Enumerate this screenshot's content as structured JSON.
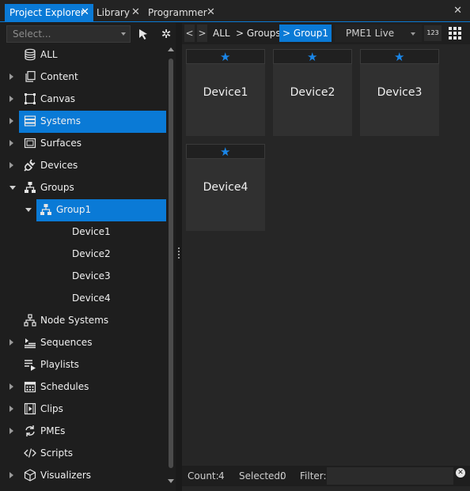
{
  "tabs": [
    {
      "label": "Project Explorer",
      "active": true
    },
    {
      "label": "Library",
      "active": false
    },
    {
      "label": "Programmer",
      "active": false
    }
  ],
  "left": {
    "select_placeholder": "Select...",
    "tree": [
      {
        "label": "ALL",
        "icon": "database-icon"
      },
      {
        "label": "Content",
        "icon": "content-icon"
      },
      {
        "label": "Canvas",
        "icon": "canvas-icon"
      },
      {
        "label": "Systems",
        "icon": "systems-icon",
        "selected": true
      },
      {
        "label": "Surfaces",
        "icon": "surfaces-icon"
      },
      {
        "label": "Devices",
        "icon": "plug-icon"
      },
      {
        "label": "Groups",
        "icon": "hierarchy-icon",
        "expanded": true
      },
      {
        "label": "Group1",
        "icon": "hierarchy-icon",
        "selected": true,
        "expanded": true
      },
      {
        "label": "Device1"
      },
      {
        "label": "Device2"
      },
      {
        "label": "Device3"
      },
      {
        "label": "Device4"
      },
      {
        "label": "Node Systems",
        "icon": "node-systems-icon"
      },
      {
        "label": "Sequences",
        "icon": "sequences-icon"
      },
      {
        "label": "Playlists",
        "icon": "playlist-icon"
      },
      {
        "label": "Schedules",
        "icon": "calendar-icon"
      },
      {
        "label": "Clips",
        "icon": "clip-icon"
      },
      {
        "label": "PMEs",
        "icon": "sync-icon"
      },
      {
        "label": "Scripts",
        "icon": "code-icon"
      },
      {
        "label": "Visualizers",
        "icon": "cube-icon"
      }
    ]
  },
  "right": {
    "breadcrumbs": {
      "back": "<",
      "forward": ">",
      "all": "ALL",
      "groups": "> Groups",
      "group1": "> Group1"
    },
    "live_select": "PME1 Live",
    "numbers_button": "123",
    "tiles": [
      "Device1",
      "Device2",
      "Device3",
      "Device4"
    ],
    "status": {
      "count_label": "Count:",
      "count": "4",
      "selected_label": "Selected:",
      "selected": "0",
      "filter_label": "Filter:"
    }
  },
  "colors": {
    "accent": "#0a7ad6",
    "star": "#1a86e8"
  }
}
